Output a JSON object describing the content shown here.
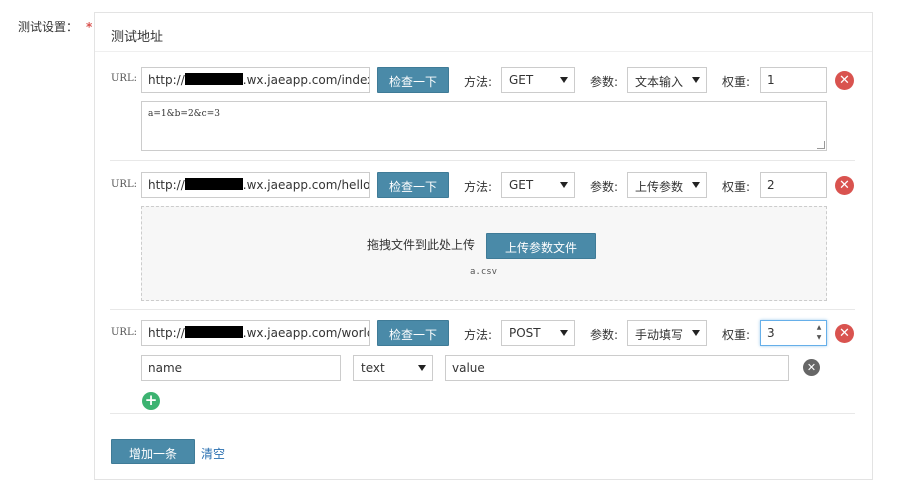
{
  "form": {
    "label": "测试设置：",
    "required_mark": "*"
  },
  "panel": {
    "title": "测试地址"
  },
  "common": {
    "url_label": "URL:",
    "check_button": "检查一下",
    "method_label": "方法:",
    "param_label": "参数:",
    "weight_label": "权重:"
  },
  "rows": [
    {
      "url_prefix": "http://",
      "url_suffix": ".wx.jaeapp.com/index.ph",
      "method": "GET",
      "param_type": "文本输入",
      "weight": "1",
      "body_text": "a=1&b=2&c=3"
    },
    {
      "url_prefix": "http://",
      "url_suffix": ".wx.jaeapp.com/hello.ph",
      "method": "GET",
      "param_type": "上传参数",
      "weight": "2",
      "drop_text": "拖拽文件到此处上传",
      "upload_button": "上传参数文件",
      "file_name": "a.csv"
    },
    {
      "url_prefix": "http://",
      "url_suffix": ".wx.jaeapp.com/world.ph",
      "method": "POST",
      "param_type": "手动填写",
      "weight": "3",
      "field_name": "name",
      "field_type": "text",
      "field_value": "value"
    }
  ],
  "footer": {
    "add_button": "增加一条",
    "clear_link": "清空"
  },
  "icons": {
    "delete": "close-circle-icon",
    "add": "plus-circle-icon",
    "select": "caret-down-icon"
  },
  "colors": {
    "primary_button": "#4a8aa8",
    "delete": "#d9534f",
    "add": "#3cb371",
    "link": "#2a6fb0",
    "required": "#d9534f"
  }
}
